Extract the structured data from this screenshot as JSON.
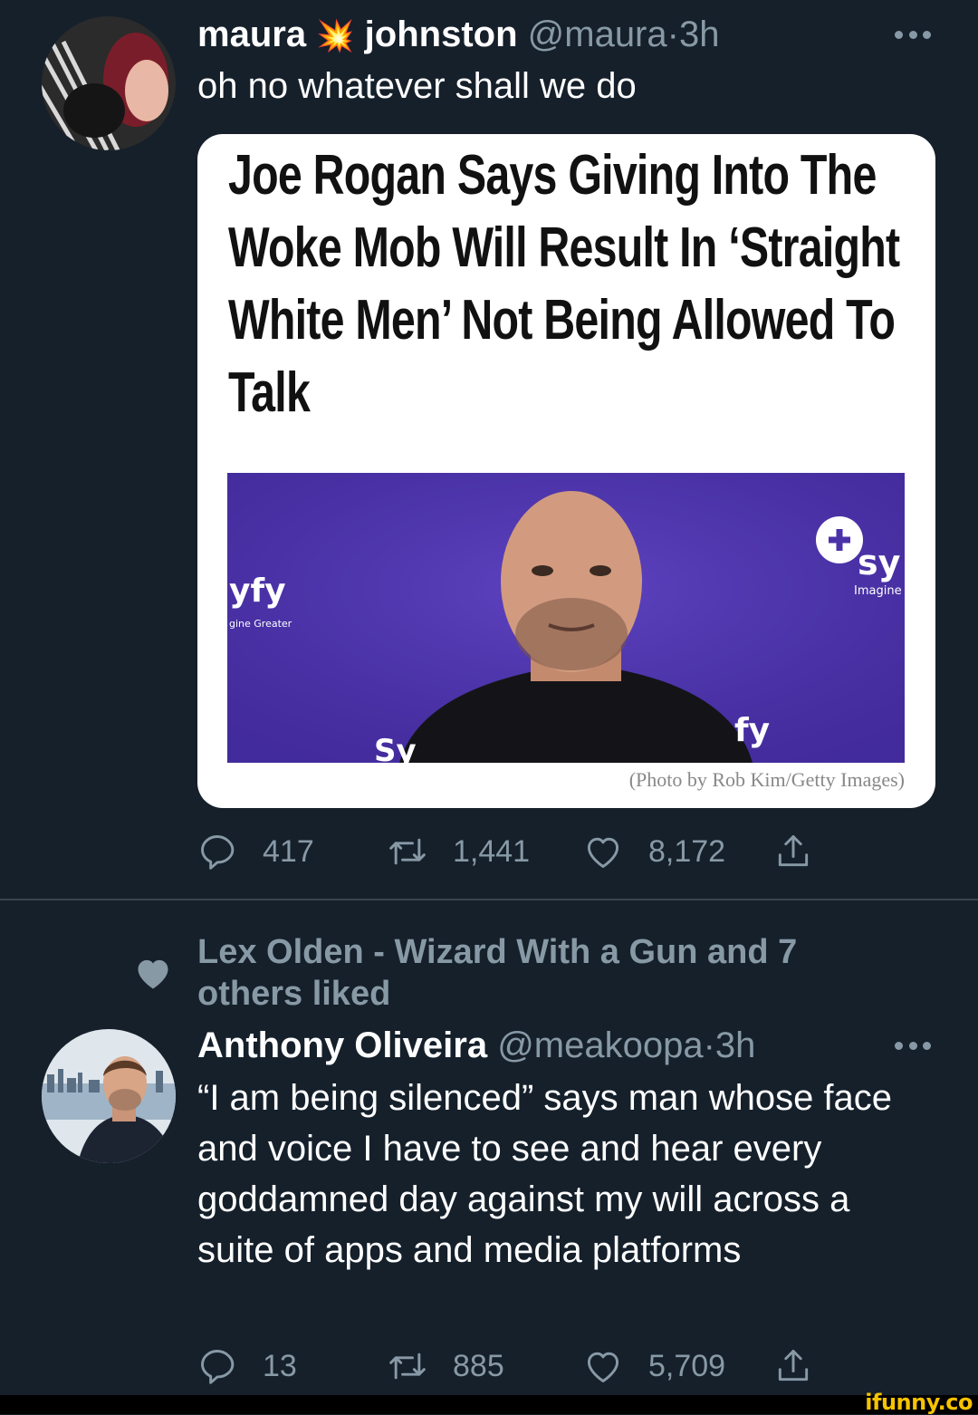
{
  "tweet1": {
    "name_first": "maura",
    "name_emoji": "💥",
    "name_last": "johnston",
    "handle": "@maura",
    "separator": "·",
    "time": "3h",
    "text": "oh no whatever shall we do",
    "card": {
      "headline": "Joe Rogan Says Giving Into The Woke Mob Will Result In ‘Straight White Men’ Not Being Allowed To Talk",
      "credit": "(Photo by Rob Kim/Getty Images)",
      "photo_logo_left": "yfy",
      "photo_tagline_left": "gine Greater",
      "photo_logo_right": "sy",
      "photo_tagline_right": "Imagine",
      "photo_logo_bottom_left": "Sy",
      "photo_logo_bottom_right": "fy"
    },
    "replies": "417",
    "retweets": "1,441",
    "likes": "8,172"
  },
  "social_context": {
    "text": "Lex Olden - Wizard With a Gun and 7 others liked"
  },
  "tweet2": {
    "name": "Anthony Oliveira",
    "handle": "@meakoopa",
    "separator": "·",
    "time": "3h",
    "text": "“I am being silenced” says man whose face and voice I have to see and hear every goddamned day against my will across a suite of apps and media platforms",
    "replies": "13",
    "retweets": "885",
    "likes": "5,709"
  },
  "watermark": "ifunny.co",
  "icons": {
    "reply": "reply-icon",
    "retweet": "retweet-icon",
    "like": "heart-icon",
    "share": "share-icon",
    "more": "more-icon"
  },
  "colors": {
    "background": "#15202b",
    "secondary_text": "#8899a6",
    "divider": "#38444d",
    "watermark": "#f7c300"
  }
}
